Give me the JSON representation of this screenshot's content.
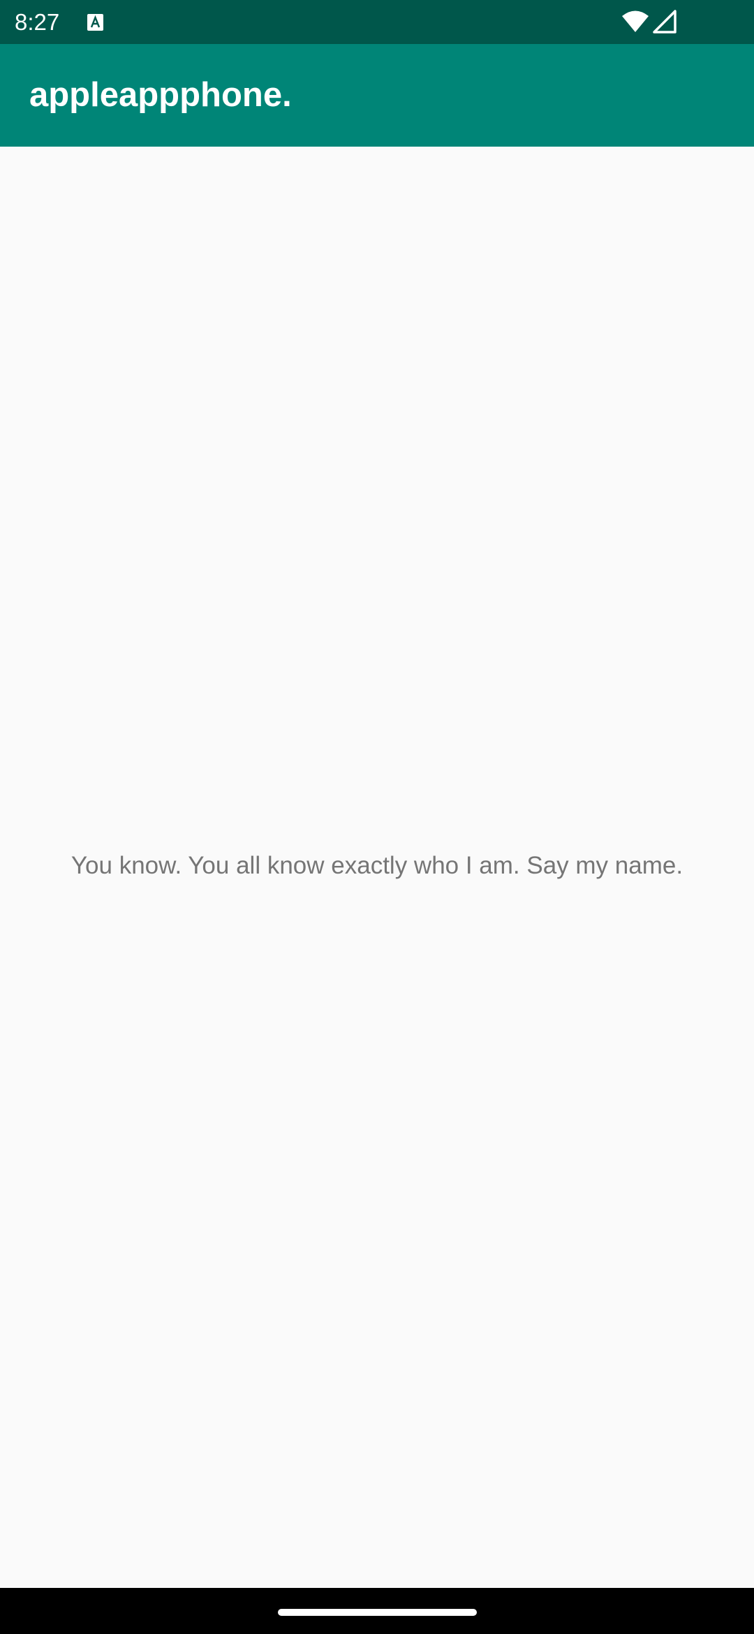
{
  "status_bar": {
    "time": "8:27",
    "icons": [
      "text-a-icon",
      "wifi-icon",
      "signal-icon"
    ],
    "color": "#00574b"
  },
  "app_bar": {
    "title": "appleappphone.",
    "color": "#008577"
  },
  "content": {
    "message": "You know. You all know exactly who I am. Say my name."
  },
  "nav_bar": {
    "icons": [
      "home-handle"
    ]
  }
}
